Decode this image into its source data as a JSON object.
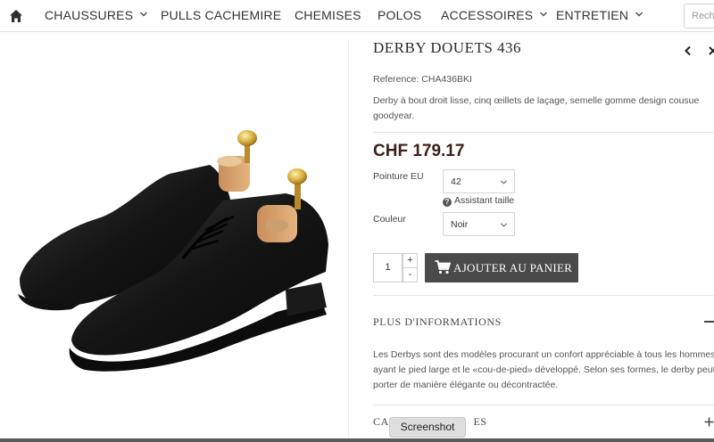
{
  "nav": {
    "home_icon": "home-icon",
    "items": [
      {
        "label": "CHAUSSURES",
        "has_dropdown": true
      },
      {
        "label": "PULLS CACHEMIRE",
        "has_dropdown": false
      },
      {
        "label": "CHEMISES",
        "has_dropdown": false
      },
      {
        "label": "POLOS",
        "has_dropdown": false
      },
      {
        "label": "ACCESSOIRES",
        "has_dropdown": true
      },
      {
        "label": "ENTRETIEN",
        "has_dropdown": true
      }
    ],
    "search_placeholder": "Rech"
  },
  "product": {
    "title": "DERBY DOUETS 436",
    "reference": "Reference: CHA436BKI",
    "description": "Derby à bout droit lisse, cinq œillets de laçage, semelle gomme design cousue goodyear.",
    "price": "CHF 179.17",
    "size_label": "Pointure EU",
    "size_value": "42",
    "size_help": "Assistant taille",
    "color_label": "Couleur",
    "color_value": "Noir",
    "quantity": "1",
    "qty_plus": "+",
    "qty_minus": "-",
    "add_to_cart": "AJOUTER AU PANIER"
  },
  "more_info": {
    "title": "PLUS D'INFORMATIONS",
    "text": "Les Derbys sont des modèles procurant un confort appréciable à tous les hommes\nayant le pied large et le «cou-de-pied» développé. Selon ses formes, le derby peut se\nporter de manière élégante ou décontractée."
  },
  "section2": {
    "title_visible": "CAR",
    "title_tail": "ES"
  },
  "tooltip": "Screenshot",
  "colors": {
    "price": "#3b1f1c",
    "button_bg": "#4a4a4a",
    "nav_text": "#333333"
  }
}
